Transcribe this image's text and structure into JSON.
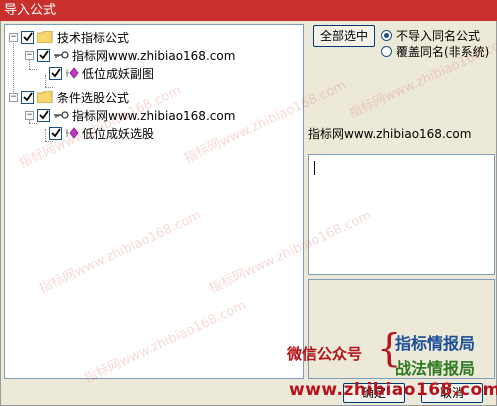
{
  "window": {
    "title": "导入公式"
  },
  "tree": {
    "nodes": [
      {
        "label": "技术指标公式",
        "expander": "−"
      },
      {
        "label": "指标网www.zhibiao168.com",
        "expander": "−"
      },
      {
        "label": "低位成妖副图"
      },
      {
        "label": "条件选股公式",
        "expander": "−"
      },
      {
        "label": "指标网www.zhibiao168.com",
        "expander": "−"
      },
      {
        "label": "低位成妖选股"
      }
    ]
  },
  "right": {
    "select_all_label": "全部选中",
    "radio_options": [
      {
        "label": "不导入同名公式",
        "selected": true
      },
      {
        "label": "覆盖同名(非系统)",
        "selected": false
      }
    ],
    "info_text": "指标网www.zhibiao168.com"
  },
  "footer": {
    "ok_label": "确定",
    "cancel_label": "取消"
  },
  "promo": {
    "wechat_label": "微信公众号",
    "account_a": "指标情报局",
    "account_b": "战法情报局",
    "url": "www.zhibiao168.com"
  },
  "watermark": {
    "text": "指标网www.zhibiao168.com"
  },
  "colors": {
    "titlebar": "#c9302c",
    "promo_red": "#b5121b",
    "promo_blue": "#1a4e9a",
    "promo_green": "#2d7a22"
  }
}
